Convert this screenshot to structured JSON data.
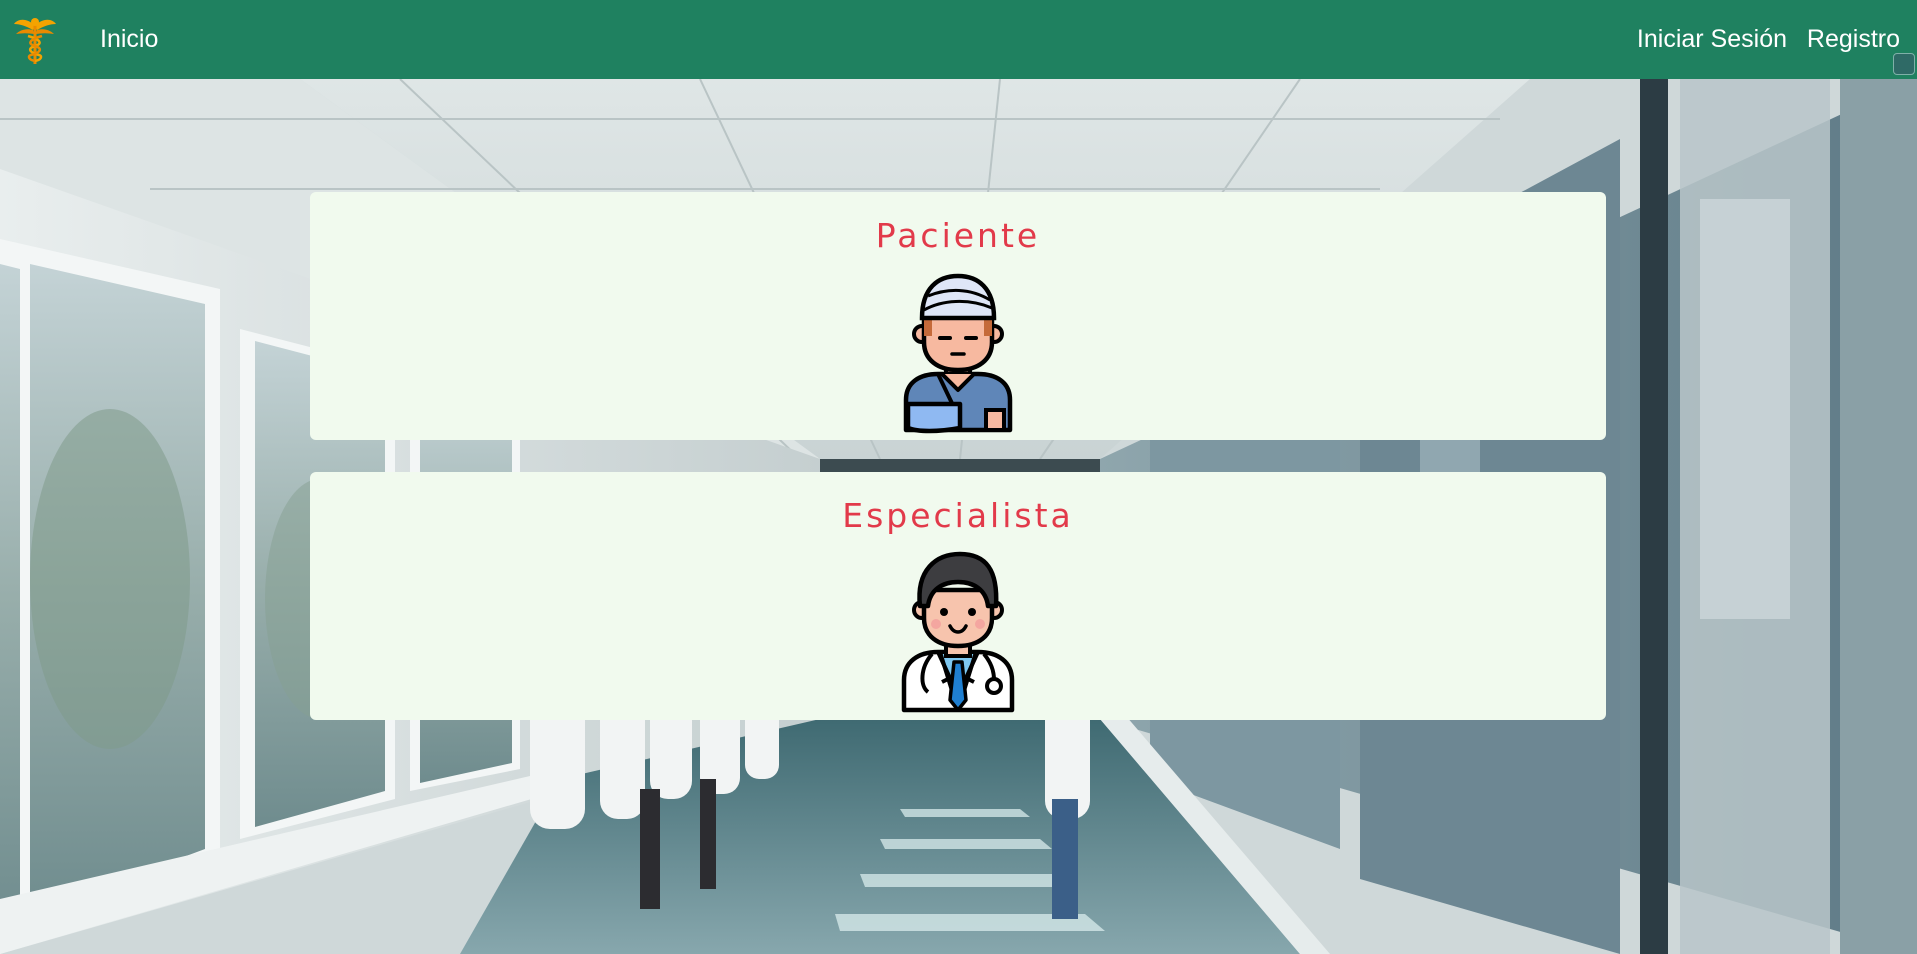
{
  "navbar": {
    "background_color": "#1f8160",
    "logo_icon": "caduceus-icon",
    "home_label": "Inicio",
    "login_label": "Iniciar Sesión",
    "register_label": "Registro",
    "corner_icon": "window-control-icon"
  },
  "background": {
    "scene": "hospital-hallway-photo"
  },
  "cards": [
    {
      "title": "Paciente",
      "icon": "bandaged-patient-icon"
    },
    {
      "title": "Especialista",
      "icon": "doctor-icon"
    }
  ],
  "colors": {
    "card_background": "#f1faee",
    "card_title": "#e23a4a",
    "navbar": "#1f8160"
  }
}
